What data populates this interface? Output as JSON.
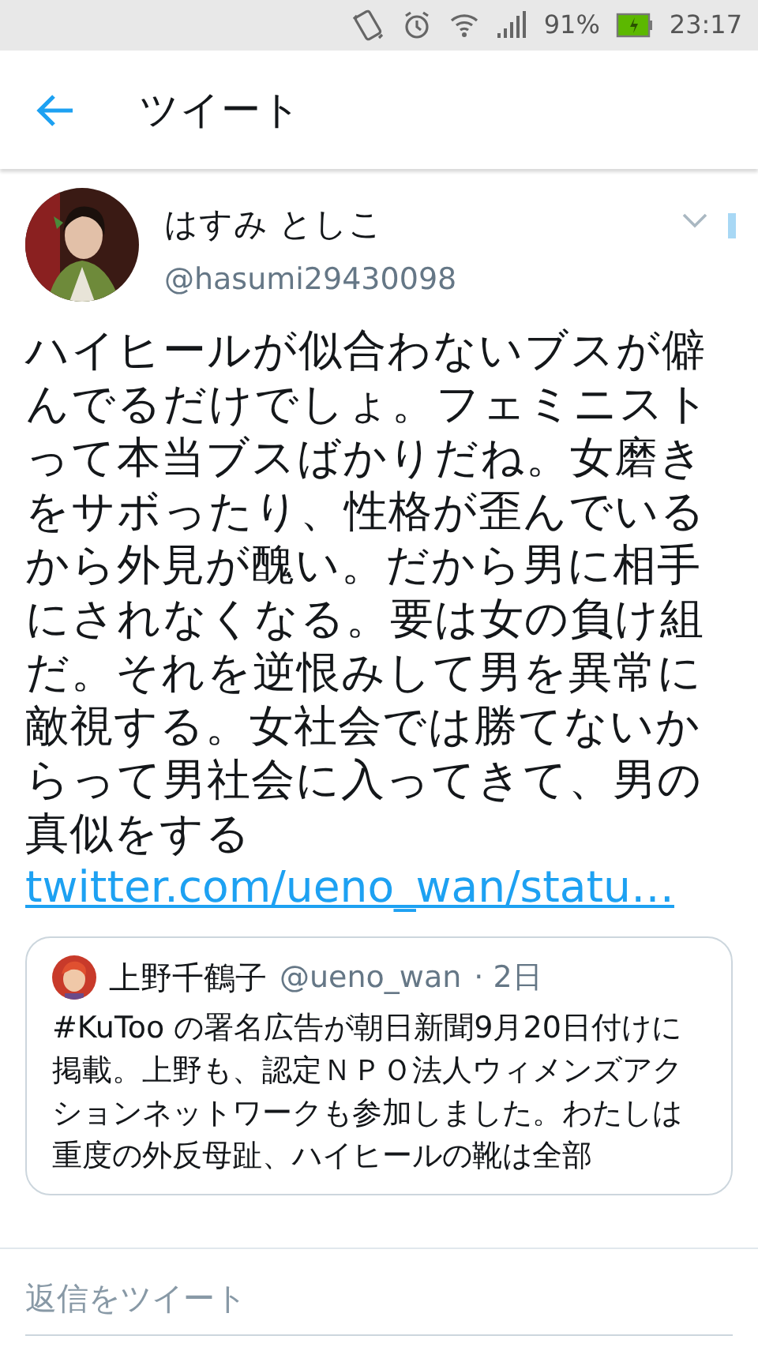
{
  "status_bar": {
    "battery_percent": "91%",
    "time": "23:17"
  },
  "header": {
    "title": "ツイート"
  },
  "tweet": {
    "name": "はすみ としこ",
    "handle": "@hasumi29430098",
    "text": "ハイヒールが似合わないブスが僻んでるだけでしょ。フェミニストって本当ブスばかりだね。女磨きをサボったり、性格が歪んでいるから外見が醜い。だから男に相手にされなくなる。要は女の負け組だ。それを逆恨みして男を異常に敵視する。女社会では勝てないからって男社会に入ってきて、男の真似をする",
    "link": "twitter.com/ueno_wan/statu…",
    "quote": {
      "name": "上野千鶴子",
      "handle": "@ueno_wan",
      "time": "· 2日",
      "text": "#KuToo の署名広告が朝日新聞9月20日付けに掲載。上野も、認定ＮＰＯ法人ウィメンズアクションネットワークも参加しました。わたしは重度の外反母趾、ハイヒールの靴は全部"
    }
  },
  "reply": {
    "placeholder": "返信をツイート"
  }
}
